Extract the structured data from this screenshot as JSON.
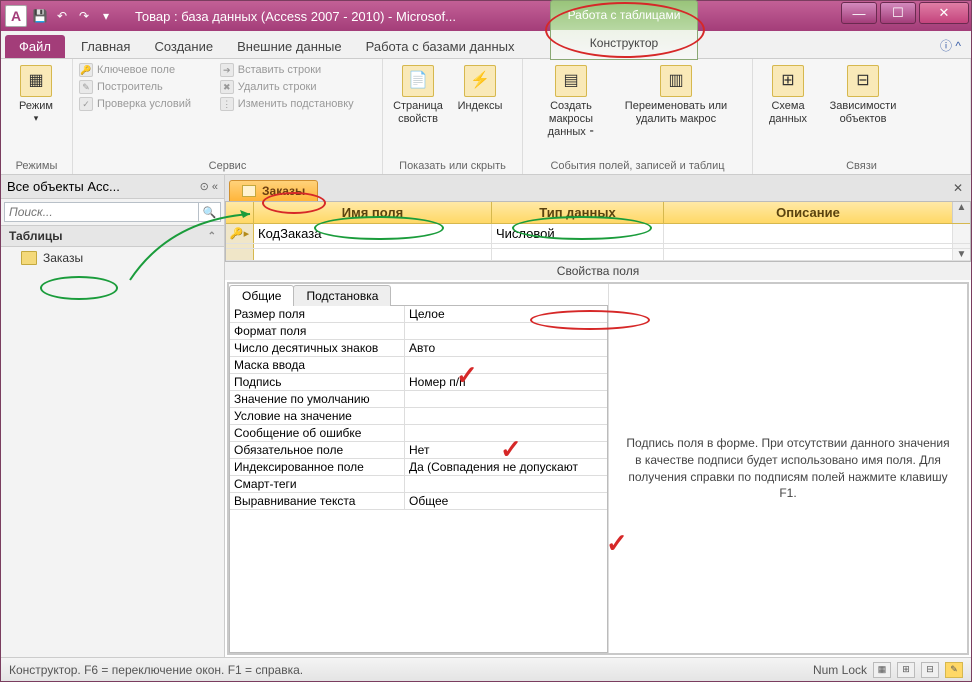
{
  "window": {
    "title": "Товар : база данных (Access 2007 - 2010) - Microsof...",
    "context_tab_title": "Работа с таблицами",
    "context_tab_sub": "Конструктор"
  },
  "tabs": {
    "file": "Файл",
    "home": "Главная",
    "create": "Создание",
    "external": "Внешние данные",
    "database": "Работа с базами данных"
  },
  "ribbon": {
    "g1_big": "Режим",
    "g1_cap": "Режимы",
    "g2_r1": "Ключевое поле",
    "g2_r2": "Построитель",
    "g2_r3": "Проверка условий",
    "g2b_r1": "Вставить строки",
    "g2b_r2": "Удалить строки",
    "g2b_r3": "Изменить подстановку",
    "g2_cap": "Сервис",
    "g3_b1": "Страница свойств",
    "g3_b2": "Индексы",
    "g3_cap": "Показать или скрыть",
    "g4_b1": "Создать макросы данных ⁃",
    "g4_b2": "Переименовать или удалить макрос",
    "g4_cap": "События полей, записей и таблиц",
    "g5_b1": "Схема данных",
    "g5_b2": "Зависимости объектов",
    "g5_cap": "Связи"
  },
  "nav": {
    "header": "Все объекты Acc...",
    "search_placeholder": "Поиск...",
    "cat": "Таблицы",
    "item1": "Заказы"
  },
  "doc": {
    "tab": "Заказы",
    "col_name": "Имя поля",
    "col_type": "Тип данных",
    "col_desc": "Описание",
    "row1_name": "КодЗаказа",
    "row1_type": "Числовой",
    "pk_glyph": "🔑▸"
  },
  "props": {
    "title": "Свойства поля",
    "tab1": "Общие",
    "tab2": "Подстановка",
    "rows": [
      {
        "k": "Размер поля",
        "v": "Целое"
      },
      {
        "k": "Формат поля",
        "v": ""
      },
      {
        "k": "Число десятичных знаков",
        "v": "Авто"
      },
      {
        "k": "Маска ввода",
        "v": ""
      },
      {
        "k": "Подпись",
        "v": "Номер п/п"
      },
      {
        "k": "Значение по умолчанию",
        "v": ""
      },
      {
        "k": "Условие на значение",
        "v": ""
      },
      {
        "k": "Сообщение об ошибке",
        "v": ""
      },
      {
        "k": "Обязательное поле",
        "v": "Нет"
      },
      {
        "k": "Индексированное поле",
        "v": "Да (Совпадения не допускают"
      },
      {
        "k": "Смарт-теги",
        "v": ""
      },
      {
        "k": "Выравнивание текста",
        "v": "Общее"
      }
    ],
    "help": "Подпись поля в форме. При отсутствии данного значения в качестве подписи будет использовано имя поля. Для получения справки по подписям полей нажмите клавишу F1."
  },
  "status": {
    "left": "Конструктор.  F6 = переключение окон.  F1 = справка.",
    "numlock": "Num Lock"
  }
}
